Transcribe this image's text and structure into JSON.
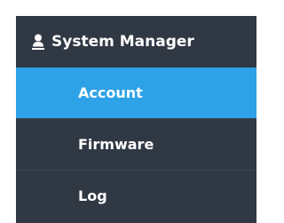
{
  "sidebar": {
    "section": {
      "icon": "user-icon",
      "title": "System Manager"
    },
    "items": [
      {
        "label": "Account",
        "active": true
      },
      {
        "label": "Firmware",
        "active": false
      },
      {
        "label": "Log",
        "active": false
      }
    ]
  },
  "colors": {
    "sidebar_bg": "#303844",
    "active_bg": "#2ea2e6",
    "text": "#ffffff"
  }
}
